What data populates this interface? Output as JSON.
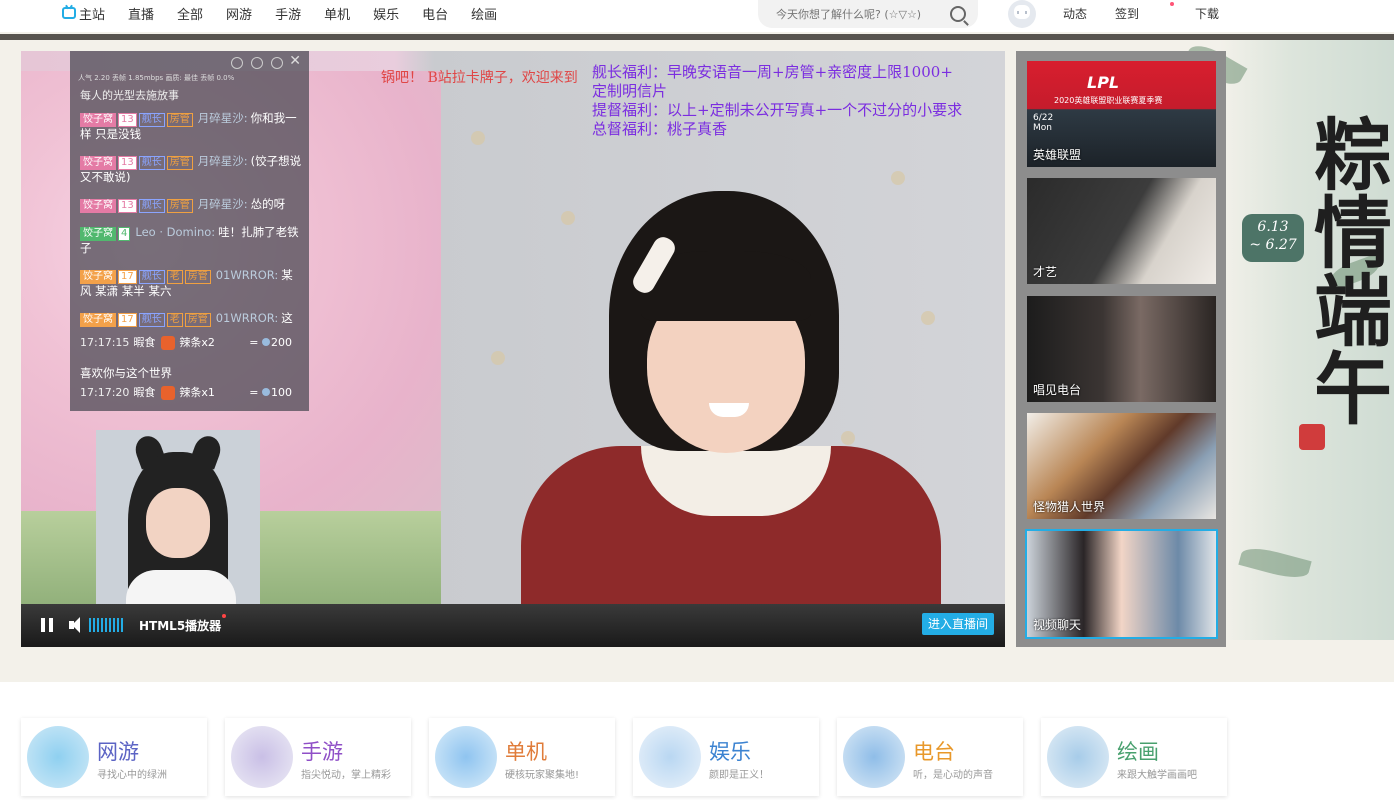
{
  "nav": {
    "items": [
      {
        "label": "主站",
        "icon": "tv-icon"
      },
      {
        "label": "直播"
      },
      {
        "label": "全部"
      },
      {
        "label": "网游"
      },
      {
        "label": "手游"
      },
      {
        "label": "单机"
      },
      {
        "label": "娱乐"
      },
      {
        "label": "电台"
      },
      {
        "label": "绘画"
      }
    ],
    "search_placeholder": "今天你想了解什么呢? (☆▽☆)",
    "links": [
      "动态",
      "签到",
      "下载"
    ]
  },
  "banner": {
    "calligraphy": "粽情端午",
    "date_badge_1": "6.13",
    "date_badge_2": "~ 6.27"
  },
  "player": {
    "notice_lines": [
      "舰长福利：早晚安语音一周+房管+亲密度上限1000+",
      "定制明信片",
      "提督福利：以上+定制未公开写真+一个不过分的小要求",
      "总督福利：桃子真香"
    ],
    "danmaku": "锅吧！ B站拉卡牌子，欢迎来到",
    "chat_stats": "人气 2.20  丢帧 1.85mbps  画质: 最佳  丢帧 0.0%",
    "chat_header": "每人的光型去施放事",
    "messages": [
      {
        "club": "饺子窝",
        "level": "13",
        "guard": "舰长",
        "admin": "房管",
        "user": "月碎星沙:",
        "text": "你和我一样 只是没钱",
        "color": "pink"
      },
      {
        "club": "饺子窝",
        "level": "13",
        "guard": "舰长",
        "admin": "房管",
        "user": "月碎星沙:",
        "text": "(饺子想说又不敢说)",
        "color": "pink"
      },
      {
        "club": "饺子窝",
        "level": "13",
        "guard": "舰长",
        "admin": "房管",
        "user": "月碎星沙:",
        "text": "怂的呀",
        "color": "pink"
      },
      {
        "club": "饺子窝",
        "level": "4",
        "user": "Leo · Domino:",
        "text": "哇！扎肺了老铁子",
        "color": "green"
      },
      {
        "club": "饺子窝",
        "level": "17",
        "guard": "舰长",
        "extra": "老",
        "admin": "房管",
        "user": "01WRROR:",
        "text": "某风 某潇 某半 某六",
        "color": "orange"
      },
      {
        "club": "饺子窝",
        "level": "17",
        "guard": "舰长",
        "extra": "老",
        "admin": "房管",
        "user": "01WRROR:",
        "text": "这",
        "color": "orange"
      }
    ],
    "gifts": [
      {
        "time": "17:17:15",
        "user": "暇食",
        "gift": "辣条x2",
        "cost": "200"
      },
      {
        "time": "17:17:20",
        "user": "暇食",
        "gift": "辣条x1",
        "cost": "100"
      }
    ],
    "gift_message": "喜欢你与这个世界",
    "player_label": "HTML5播放器",
    "enter_button": "进入直播间",
    "volume_level": 1.0
  },
  "sidebar_cards": [
    {
      "label": "英雄联盟",
      "brand": "LPL",
      "subtitle": "2020英雄联盟职业联赛夏季赛",
      "date": "6/22",
      "weekday": "Mon"
    },
    {
      "label": "才艺"
    },
    {
      "label": "唱见电台"
    },
    {
      "label": "怪物猎人世界"
    },
    {
      "label": "视频聊天",
      "active": true
    }
  ],
  "categories": [
    {
      "title": "网游",
      "desc": "寻找心中的绿洲",
      "color": "#5b63c4"
    },
    {
      "title": "手游",
      "desc": "指尖悦动，掌上精彩",
      "color": "#8f4fc7"
    },
    {
      "title": "单机",
      "desc": "硬核玩家聚集地!",
      "color": "#e07c3a"
    },
    {
      "title": "娱乐",
      "desc": "颜即是正义！",
      "color": "#3c83d1"
    },
    {
      "title": "电台",
      "desc": "听，是心动的声音",
      "color": "#e8982a"
    },
    {
      "title": "绘画",
      "desc": "来跟大触学画画吧",
      "color": "#48a06e"
    }
  ]
}
